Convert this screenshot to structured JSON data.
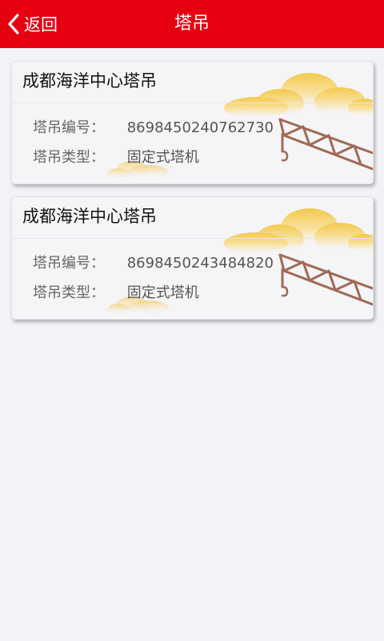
{
  "header": {
    "back_label": "返回",
    "title": "塔吊",
    "background_color": "#e60012",
    "back_icon": "chevron-left-icon"
  },
  "fields": {
    "id_label": "塔吊编号：",
    "type_label": "塔吊类型："
  },
  "cranes": [
    {
      "name": "成都海洋中心塔吊",
      "id": "8698450240762730",
      "type": "固定式塔机"
    },
    {
      "name": "成都海洋中心塔吊",
      "id": "8698450243484820",
      "type": "固定式塔机"
    }
  ]
}
